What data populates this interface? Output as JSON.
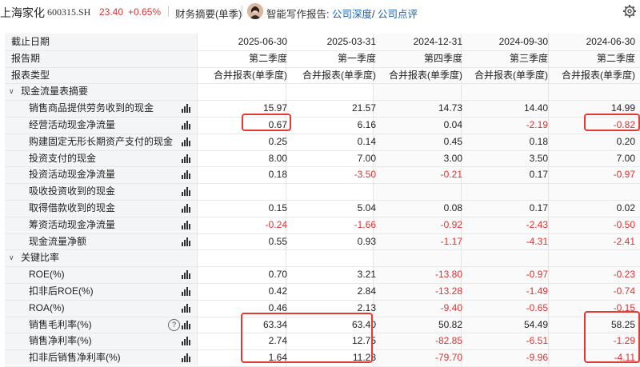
{
  "header": {
    "stock_name": "上海家化",
    "stock_code": "600315.SH",
    "price": "23.40",
    "change": "+0.65%",
    "summary_label": "财务摘要(单季)",
    "ai_label": "智能写作报告:",
    "link_deep": "公司深度",
    "link_sep": "/",
    "link_review": "公司点评",
    "price_color": "#e03131"
  },
  "table": {
    "header_rows": [
      {
        "label": "截止日期",
        "values": [
          "2025-06-30",
          "2025-03-31",
          "2024-12-31",
          "2024-09-30",
          "2024-06-30"
        ]
      },
      {
        "label": "报告期",
        "values": [
          "第二季度",
          "第一季度",
          "第四季度",
          "第三季度",
          "第二季度"
        ]
      },
      {
        "label": "报表类型",
        "values": [
          "合并报表(单季度)",
          "合并报表(单季度)",
          "合并报表(单季度)",
          "合并报表(单季度)",
          "合并报表(单季度)"
        ]
      }
    ],
    "section_cashflow": "现金流量表摘要",
    "cashflow_rows": [
      {
        "label": "销售商品提供劳务收到的现金",
        "values": [
          "15.97",
          "21.57",
          "14.73",
          "14.40",
          "14.99"
        ]
      },
      {
        "label": "经营活动现金净流量",
        "values": [
          "0.67",
          "6.16",
          "0.04",
          "-2.19",
          "-0.82"
        ]
      },
      {
        "label": "购建固定无形长期资产支付的现金",
        "values": [
          "0.25",
          "0.14",
          "0.45",
          "0.18",
          "0.20"
        ]
      },
      {
        "label": "投资支付的现金",
        "values": [
          "8.00",
          "7.00",
          "3.00",
          "3.50",
          "7.00"
        ]
      },
      {
        "label": "投资活动现金净流量",
        "values": [
          "0.18",
          "-3.50",
          "-0.21",
          "0.17",
          "-0.97"
        ]
      },
      {
        "label": "吸收投资收到的现金",
        "values": [
          "",
          "",
          "",
          "",
          ""
        ]
      },
      {
        "label": "取得借款收到的现金",
        "values": [
          "0.15",
          "5.04",
          "0.08",
          "0.17",
          "0.02"
        ]
      },
      {
        "label": "筹资活动现金净流量",
        "values": [
          "-0.24",
          "-1.66",
          "-0.92",
          "-2.43",
          "-0.50"
        ]
      },
      {
        "label": "现金流量净额",
        "values": [
          "0.55",
          "0.93",
          "-1.17",
          "-4.31",
          "-2.41"
        ]
      }
    ],
    "section_ratios": "关键比率",
    "ratio_rows": [
      {
        "label": "ROE(%)",
        "values": [
          "0.70",
          "3.21",
          "-13.80",
          "-0.97",
          "-0.23"
        ]
      },
      {
        "label": "扣非后ROE(%)",
        "values": [
          "0.42",
          "2.84",
          "-13.28",
          "-1.49",
          "-0.74"
        ]
      },
      {
        "label": "ROA(%)",
        "values": [
          "0.46",
          "2.13",
          "-9.40",
          "-0.65",
          "-0.15"
        ]
      },
      {
        "label": "销售毛利率(%)",
        "values": [
          "63.34",
          "63.40",
          "50.82",
          "54.49",
          "58.25"
        ]
      },
      {
        "label": "销售净利率(%)",
        "values": [
          "2.74",
          "12.75",
          "-82.85",
          "-6.51",
          "-1.29"
        ]
      },
      {
        "label": "扣非后销售净利率(%)",
        "values": [
          "1.64",
          "11.28",
          "-79.70",
          "-9.96",
          "-4.11"
        ]
      }
    ],
    "help_icon_text": "?"
  }
}
